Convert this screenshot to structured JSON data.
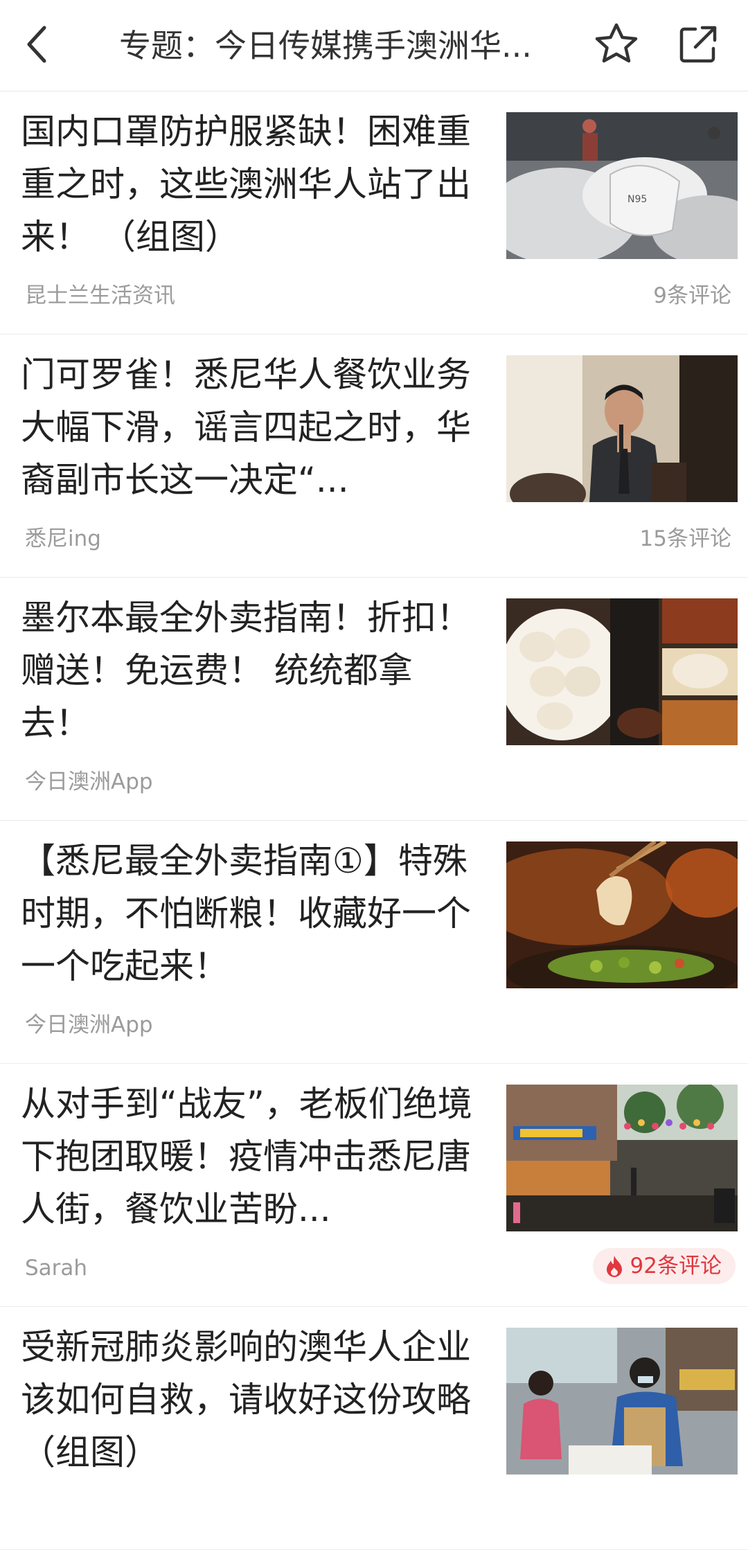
{
  "header": {
    "title": "专题：今日传媒携手澳洲华..."
  },
  "articles": [
    {
      "title": "国内口罩防护服紧缺！困难重重之时，这些澳洲华人站了出来！ （组图）",
      "source": "昆士兰生活资讯",
      "comments": "9条评论",
      "image": "masks-photo"
    },
    {
      "title": "门可罗雀！悉尼华人餐饮业务大幅下滑，谣言四起之时，华裔副市长这一决定“...",
      "source": "悉尼ing",
      "comments": "15条评论",
      "image": "speaker-photo"
    },
    {
      "title": "墨尔本最全外卖指南！折扣！赠送！免运费！  统统都拿去！",
      "source": "今日澳洲App",
      "comments": "",
      "image": "dumplings-photo"
    },
    {
      "title": "【悉尼最全外卖指南①】特殊时期，不怕断粮！收藏好一个一个吃起来！",
      "source": "今日澳洲App",
      "comments": "",
      "image": "dumpling-chopsticks-photo"
    },
    {
      "title": "从对手到“战友”，老板们绝境下抱团取暖！疫情冲击悉尼唐人街，餐饮业苦盼...",
      "source": "Sarah",
      "comments": "92条评论",
      "hot": true,
      "image": "chinatown-street-photo"
    },
    {
      "title": "受新冠肺炎影响的澳华人企业该如何自救，请收好这份攻略（组图）",
      "source": "",
      "comments": "",
      "image": "market-workers-photo"
    }
  ],
  "colors": {
    "hot": "#e0383e",
    "hot_bg": "#fdecec",
    "meta": "#9b9b9b"
  }
}
